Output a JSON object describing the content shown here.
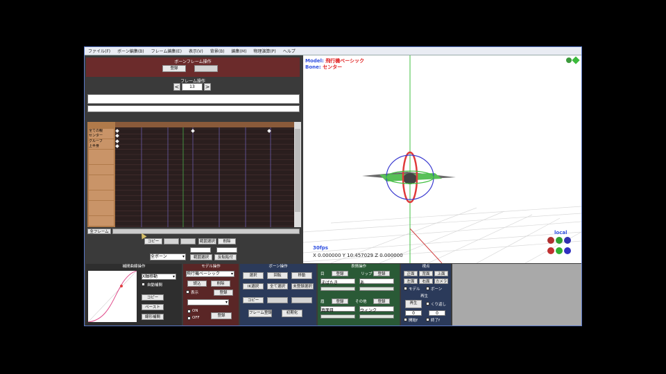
{
  "menu": [
    "ファイル(F)",
    "ボーン編集(B)",
    "フレーム編集(E)",
    "表示(V)",
    "背景(B)",
    "編集(M)",
    "物理演算(P)",
    "ヘルプ"
  ],
  "frame_panel": {
    "title": "ボーンフレーム操作",
    "register_label": "登録",
    "register_disabled_label": "",
    "frame_label": "フレーム操作",
    "frame_value": "13",
    "prev_icon": "<",
    "next_icon": ">"
  },
  "timeline": {
    "bone_names": [
      "全ての親",
      "センター",
      "グルーブ",
      "上半身",
      "",
      "",
      "",
      "",
      "",
      "",
      "",
      "",
      "",
      "",
      "",
      "",
      "",
      "",
      ""
    ],
    "scroll_label": "全フレーム"
  },
  "timeline_controls": {
    "select_all": "範囲選択",
    "delete": "削除",
    "copy": "コピー",
    "paste": "",
    "paste2": "",
    "range_select": "範囲選択",
    "range_paste": "反転貼付",
    "mode_dropdown": "全ボーン"
  },
  "viewport": {
    "model_label": "Model",
    "model_value": "飛行機ベーシック",
    "bone_label": "Bone",
    "bone_value": "センター",
    "fps": "30fps",
    "coords": "X 0.000000 Y 10.457029 Z 0.000000",
    "local_label": "local"
  },
  "interp_panel": {
    "title": "補間曲線操作",
    "axis_dropdown": "X軸移動",
    "auto_label": "自動補間",
    "copy": "コピー",
    "paste": "ペースト",
    "linear": "線形補間"
  },
  "model_panel": {
    "title": "モデル操作",
    "model_dropdown": "飛行機ベーシック",
    "load": "読込",
    "delete": "削除",
    "show_label": "表示",
    "register": "登録",
    "ext_dropdown": "",
    "on_label": "ON",
    "off_label": "OFF"
  },
  "bone_panel": {
    "title": "ボーン操作",
    "select": "選択",
    "rotate": "回転",
    "move": "移動",
    "ik_select": "IK選択",
    "all_select": "全て選択",
    "unregistered_select": "未登録選択",
    "copy": "コピー",
    "paste": "",
    "reverse_paste": "",
    "frame_register": "フレーム登録",
    "initialize": "初期化"
  },
  "camera_panel": {
    "title": "表情操作",
    "eye": "目",
    "lip": "リップ",
    "brow": "眉",
    "other": "その他",
    "register": "登録",
    "dd1": "まばたき",
    "dd2": "あ",
    "dd3": "真面目",
    "dd4": "ウィンク"
  },
  "view_panel": {
    "title": "視点",
    "front": "正面",
    "back": "背面",
    "top": "上面",
    "left": "左面",
    "right": "右面",
    "camera": "カメラ",
    "model_label": "モデル",
    "bone_label": "ボーン",
    "play_title": "再生",
    "play": "再生",
    "loop_label": "くり返し",
    "from": "0",
    "to": "0",
    "from_label": "開始f",
    "to_label": "終了f"
  }
}
